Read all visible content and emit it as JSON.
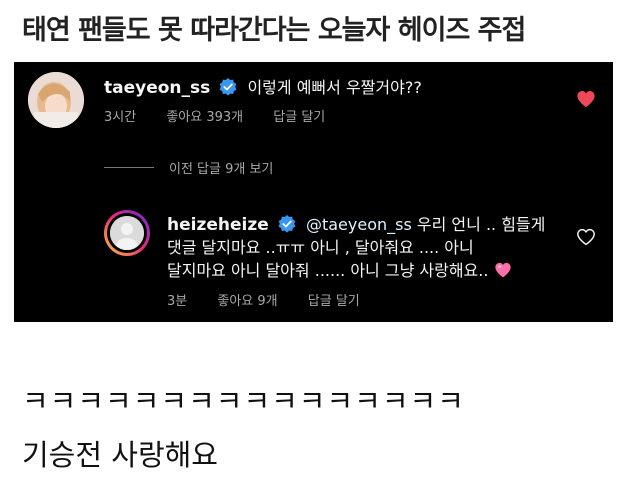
{
  "headline": "태연 팬들도 못 따라간다는 오늘자 헤이즈 주접",
  "post_comment": {
    "username": "taeyeon_ss",
    "text": "이렇게 예뻐서 우짤거야??",
    "time": "3시간",
    "likes": "좋아요 393개",
    "reply_label": "답글 달기",
    "liked": true
  },
  "view_previous": "이전 답글 9개 보기",
  "reply_comment": {
    "username": "heizeheize",
    "mention": "@taeyeon_ss",
    "line1_text": "우리 언니 .. 힘들게",
    "line2": "댓글 달지마요 ..ㅠㅠ 아니 , 달아줘요 .... 아니",
    "line3": "달지마요 아니 달아줘 ...... 아니 그냥 사랑해요..",
    "time": "3분",
    "likes": "좋아요 9개",
    "reply_label": "답글 달기",
    "liked": false
  },
  "reaction": "ㅋㅋㅋㅋㅋㅋㅋㅋㅋㅋㅋㅋㅋㅋㅋㅋ",
  "caption": "기승전 사랑해요",
  "colors": {
    "verified": "#3897f0",
    "like_red": "#ed4956",
    "heart_emoji": "#ff6fa8"
  },
  "icons": [
    "verified-badge-icon",
    "heart-filled-icon",
    "heart-outline-icon",
    "pink-heart-emoji-icon"
  ]
}
